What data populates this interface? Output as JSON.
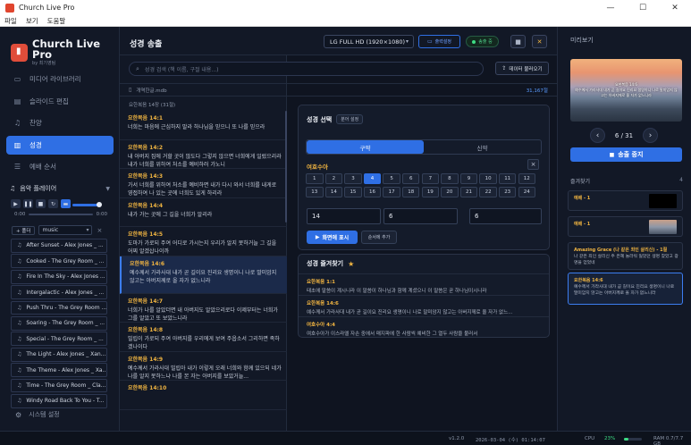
{
  "window": {
    "title": "Church Live Pro",
    "menu": [
      "파일",
      "보기",
      "도움말"
    ]
  },
  "sidebar": {
    "brand_name": "Church Live Pro",
    "brand_sub": "by 최기영팀",
    "nav": [
      {
        "label": "미디어 라이브러리",
        "icon": "video-icon"
      },
      {
        "label": "슬라이드 편집",
        "icon": "slides-icon"
      },
      {
        "label": "찬양",
        "icon": "music-note-icon"
      },
      {
        "label": "성경",
        "icon": "book-icon"
      },
      {
        "label": "예배 순서",
        "icon": "list-icon"
      }
    ],
    "active_nav": 3,
    "player": {
      "title": "음악 플레이어",
      "time_start": "0:00",
      "time_end": "0:00",
      "add_label": "+ 폴더",
      "playlist": "music",
      "tracks": [
        "After Sunset - Alex Jones _ ...",
        "Cooked - The Grey Room _ ...",
        "Fire In The Sky - Alex Jones ...",
        "Intergalactic - Alex Jones _ ...",
        "Push Thru - The Grey Room ...",
        "Soaring - The Grey Room _ ...",
        "Special - The Grey Room _ ...",
        "The Light - Alex Jones _ Xan...",
        "The Theme - Alex Jones _ Xa...",
        "Time - The Grey Room _ Cla...",
        "Windy Road Back To You - T..."
      ]
    },
    "settings_label": "시스템 설정"
  },
  "header": {
    "title": "성경 송출",
    "resolution": "LG FULL HD (1920×1080)",
    "output_label": "출력설정",
    "status_label": "송출 중"
  },
  "list": {
    "search_placeholder": "성경 검색 (책 이름, 구절 내용...)",
    "load_db_label": "데이터 불러오기",
    "db_file": "개역한글.mdb",
    "db_count": "31,167절",
    "range_label": "요한복음 14장 (31절)",
    "verses": [
      {
        "ref": "요한복음 14:1",
        "text": "너희는 마음에 근심하지 말라 하나님을 믿으니 또 나를 믿으라"
      },
      {
        "ref": "요한복음 14:2",
        "text": "내 아버지 집에 거할 곳이 많도다 그렇지 않으면 너희에게 일렀으리라 내가 너희를 위하여 처소를 예비하러 가노니"
      },
      {
        "ref": "요한복음 14:3",
        "text": "가서 너희를 위하여 처소를 예비하면 내가 다시 와서 너희를 내게로 영접하여 나 있는 곳에 너희도 있게 하리라"
      },
      {
        "ref": "요한복음 14:4",
        "text": "내가 가는 곳에 그 길을 너희가 알리라"
      },
      {
        "ref": "요한복음 14:5",
        "text": "도마가 가로되 주여 어디로 가시는지 우리가 알지 못하거늘 그 길을 어찌 알겠삽나이까"
      },
      {
        "ref": "요한복음 14:6",
        "text": "예수께서 가라사대 내가 곧 길이요 진리요 생명이니 나로 말미암지 않고는 아버지께로 올 자가 없느니라"
      },
      {
        "ref": "요한복음 14:7",
        "text": "너희가 나를 알았더면 내 아버지도 알았으리로다 이제부터는 너희가 그를 알았고 또 보았느니라"
      },
      {
        "ref": "요한복음 14:8",
        "text": "빌립이 가로되 주여 아버지를 우리에게 보여 주옵소서 그리하면 족하겠나이다"
      },
      {
        "ref": "요한복음 14:9",
        "text": "예수께서 가라사대 빌립아 내가 이렇게 오래 너희와 함께 있으되 네가 나를 알지 못하느냐 나를 본 자는 아버지를 보았거늘..."
      },
      {
        "ref": "요한복음 14:10",
        "text": ""
      }
    ],
    "selected": 5
  },
  "select_card": {
    "title": "성경 선택",
    "split_label": "분어 설정",
    "tabs": [
      "구약",
      "신약"
    ],
    "active_tab": 0,
    "book": "여호수아",
    "chapters": [
      "1",
      "2",
      "3",
      "4",
      "5",
      "6",
      "7",
      "8",
      "9",
      "10",
      "11",
      "12",
      "13",
      "14",
      "15",
      "16",
      "17",
      "18",
      "19",
      "20",
      "21",
      "22",
      "23",
      "24"
    ],
    "active_chapter": 3,
    "input_chapter": "14",
    "input_from": "6",
    "input_to": "6",
    "range_dash": "-",
    "show_label": "화면에 표시",
    "order_label": "순서에 추가"
  },
  "fav_card": {
    "title": "성경 즐겨찾기",
    "items": [
      {
        "ref": "요한복음 1:1",
        "text": "태초에 말씀이 계시니라 이 말씀이 하나님과 함께 계셨으니 이 말씀은 곧 하나님이시니라"
      },
      {
        "ref": "요한복음 14:6",
        "text": "예수께서 가라사대 내가 곧 길이요 진리요 생명이니 나로 말미암지 않고는 아버지께로 올 자가 없느..."
      },
      {
        "ref": "여호수아 4:4",
        "text": "여호수아가 이스라엘 자손 중에서 매지파에 한 사람씩 예비한 그 열두 사람을 불러서"
      }
    ]
  },
  "preview": {
    "title": "미리보기",
    "text": "요한복음 14:6\n예수께서 가라사대 내가 곧 길이요 진리요 생명이니 나로 말미암지 않고는 아버지께로 올 자가 없느니라",
    "page": "6 / 31",
    "stop_label": "송출 중지",
    "favorites_title": "즐겨찾기",
    "favorites_count": "4",
    "favorites": [
      {
        "ref": "예배 - 1",
        "text": "",
        "thumb": "black"
      },
      {
        "ref": "예배 - 1",
        "text": "",
        "thumb": "image"
      },
      {
        "ref": "Amazing Grace (나 같은 죄인 살리신) - 1절",
        "text": "나 같은 죄인 살리신 주 은혜 놀라워 잃었던 생명 찾았고 광명을 얻었네",
        "thumb": ""
      },
      {
        "ref": "요한복음 14:6",
        "text": "예수께서 가라사대 내가 곧 길이요 진리요 생명이니 나로 말미암지 않고는 아버지께로 올 자가 없느니라",
        "thumb": ""
      }
    ]
  },
  "status": {
    "version": "v1.2.0",
    "datetime": "2026-03-04 (수) 01:14:07",
    "cpu_label": "CPU",
    "cpu_value": "23%",
    "cpu_fraction": 0.23,
    "ram": "RAM 0.7/7.7 GB"
  }
}
